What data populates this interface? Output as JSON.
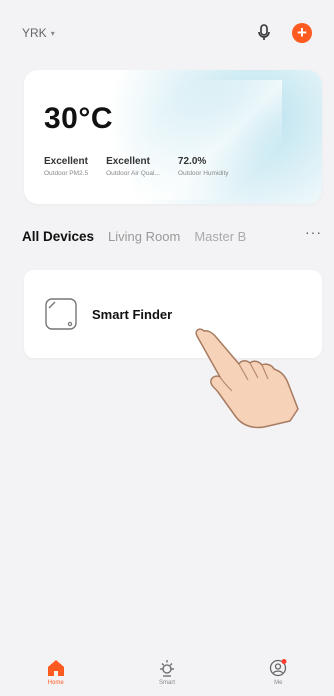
{
  "header": {
    "home_name": "YRK",
    "home_caret": "▾"
  },
  "weather": {
    "temperature": "30°C",
    "metrics": [
      {
        "value": "Excellent",
        "label": "Outdoor PM2.5"
      },
      {
        "value": "Excellent",
        "label": "Outdoor Air Qual..."
      },
      {
        "value": "72.0%",
        "label": "Outdoor Humidity"
      }
    ]
  },
  "rooms": {
    "tabs": [
      "All Devices",
      "Living Room",
      "Master B"
    ],
    "more": "···"
  },
  "devices": [
    {
      "name": "Smart Finder"
    }
  ],
  "nav": {
    "items": [
      {
        "label": "Home"
      },
      {
        "label": "Smart"
      },
      {
        "label": "Me"
      }
    ]
  },
  "colors": {
    "accent": "#ff5a1f",
    "background": "#f3f3f5"
  }
}
